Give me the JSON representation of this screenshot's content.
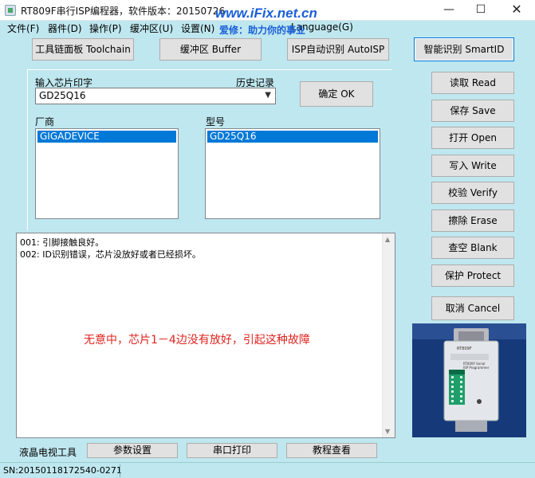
{
  "window": {
    "title": "RT809F串行ISP编程器，软件版本：20150726",
    "watermark": "www.iFix.net.cn",
    "watermark_sub": "爱修：助力你的事业",
    "minimize_glyph": "—",
    "maximize_glyph": "☐",
    "close_glyph": "✕"
  },
  "menu": [
    {
      "label": "文件(F)"
    },
    {
      "label": "器件(D)"
    },
    {
      "label": "操作(P)"
    },
    {
      "label": "缓冲区(U)"
    },
    {
      "label": "设置(N)"
    },
    {
      "label": "Language(G)"
    }
  ],
  "toolbar": {
    "toolchain": "工具链面板 Toolchain",
    "buffer": "缓冲区 Buffer",
    "isp_auto": "ISP自动识别 AutoISP",
    "smart_id": "智能识别 SmartID"
  },
  "chip": {
    "input_label": "输入芯片印字",
    "history_label": "历史记录",
    "input_value": "GD25Q16",
    "confirm": "确定 OK",
    "vendor_label": "厂商",
    "model_label": "型号",
    "vendor_selected": "GIGADEVICE",
    "model_selected": "GD25Q16"
  },
  "actions": {
    "read": "读取 Read",
    "save": "保存 Save",
    "open": "打开 Open",
    "write": "写入 Write",
    "verify": "校验 Verify",
    "erase": "擦除 Erase",
    "blank": "查空 Blank",
    "protect": "保护 Protect",
    "cancel": "取消 Cancel"
  },
  "log": {
    "lines": [
      "001:  引脚接触良好。",
      "002:  ID识别错误，芯片没放好或者已经损坏。"
    ],
    "note": "无意中，芯片1－4边没有放好，引起这种故障"
  },
  "device_photo": {
    "label_line1": "RT809F Serial",
    "label_line2": "ISP Programmer"
  },
  "bottom": {
    "tv_tools": "液晶电视工具",
    "params": "参数设置",
    "serial_print": "串口打印",
    "tutorial": "教程查看"
  },
  "status": {
    "sn": "SN:20150118172540-0271"
  }
}
